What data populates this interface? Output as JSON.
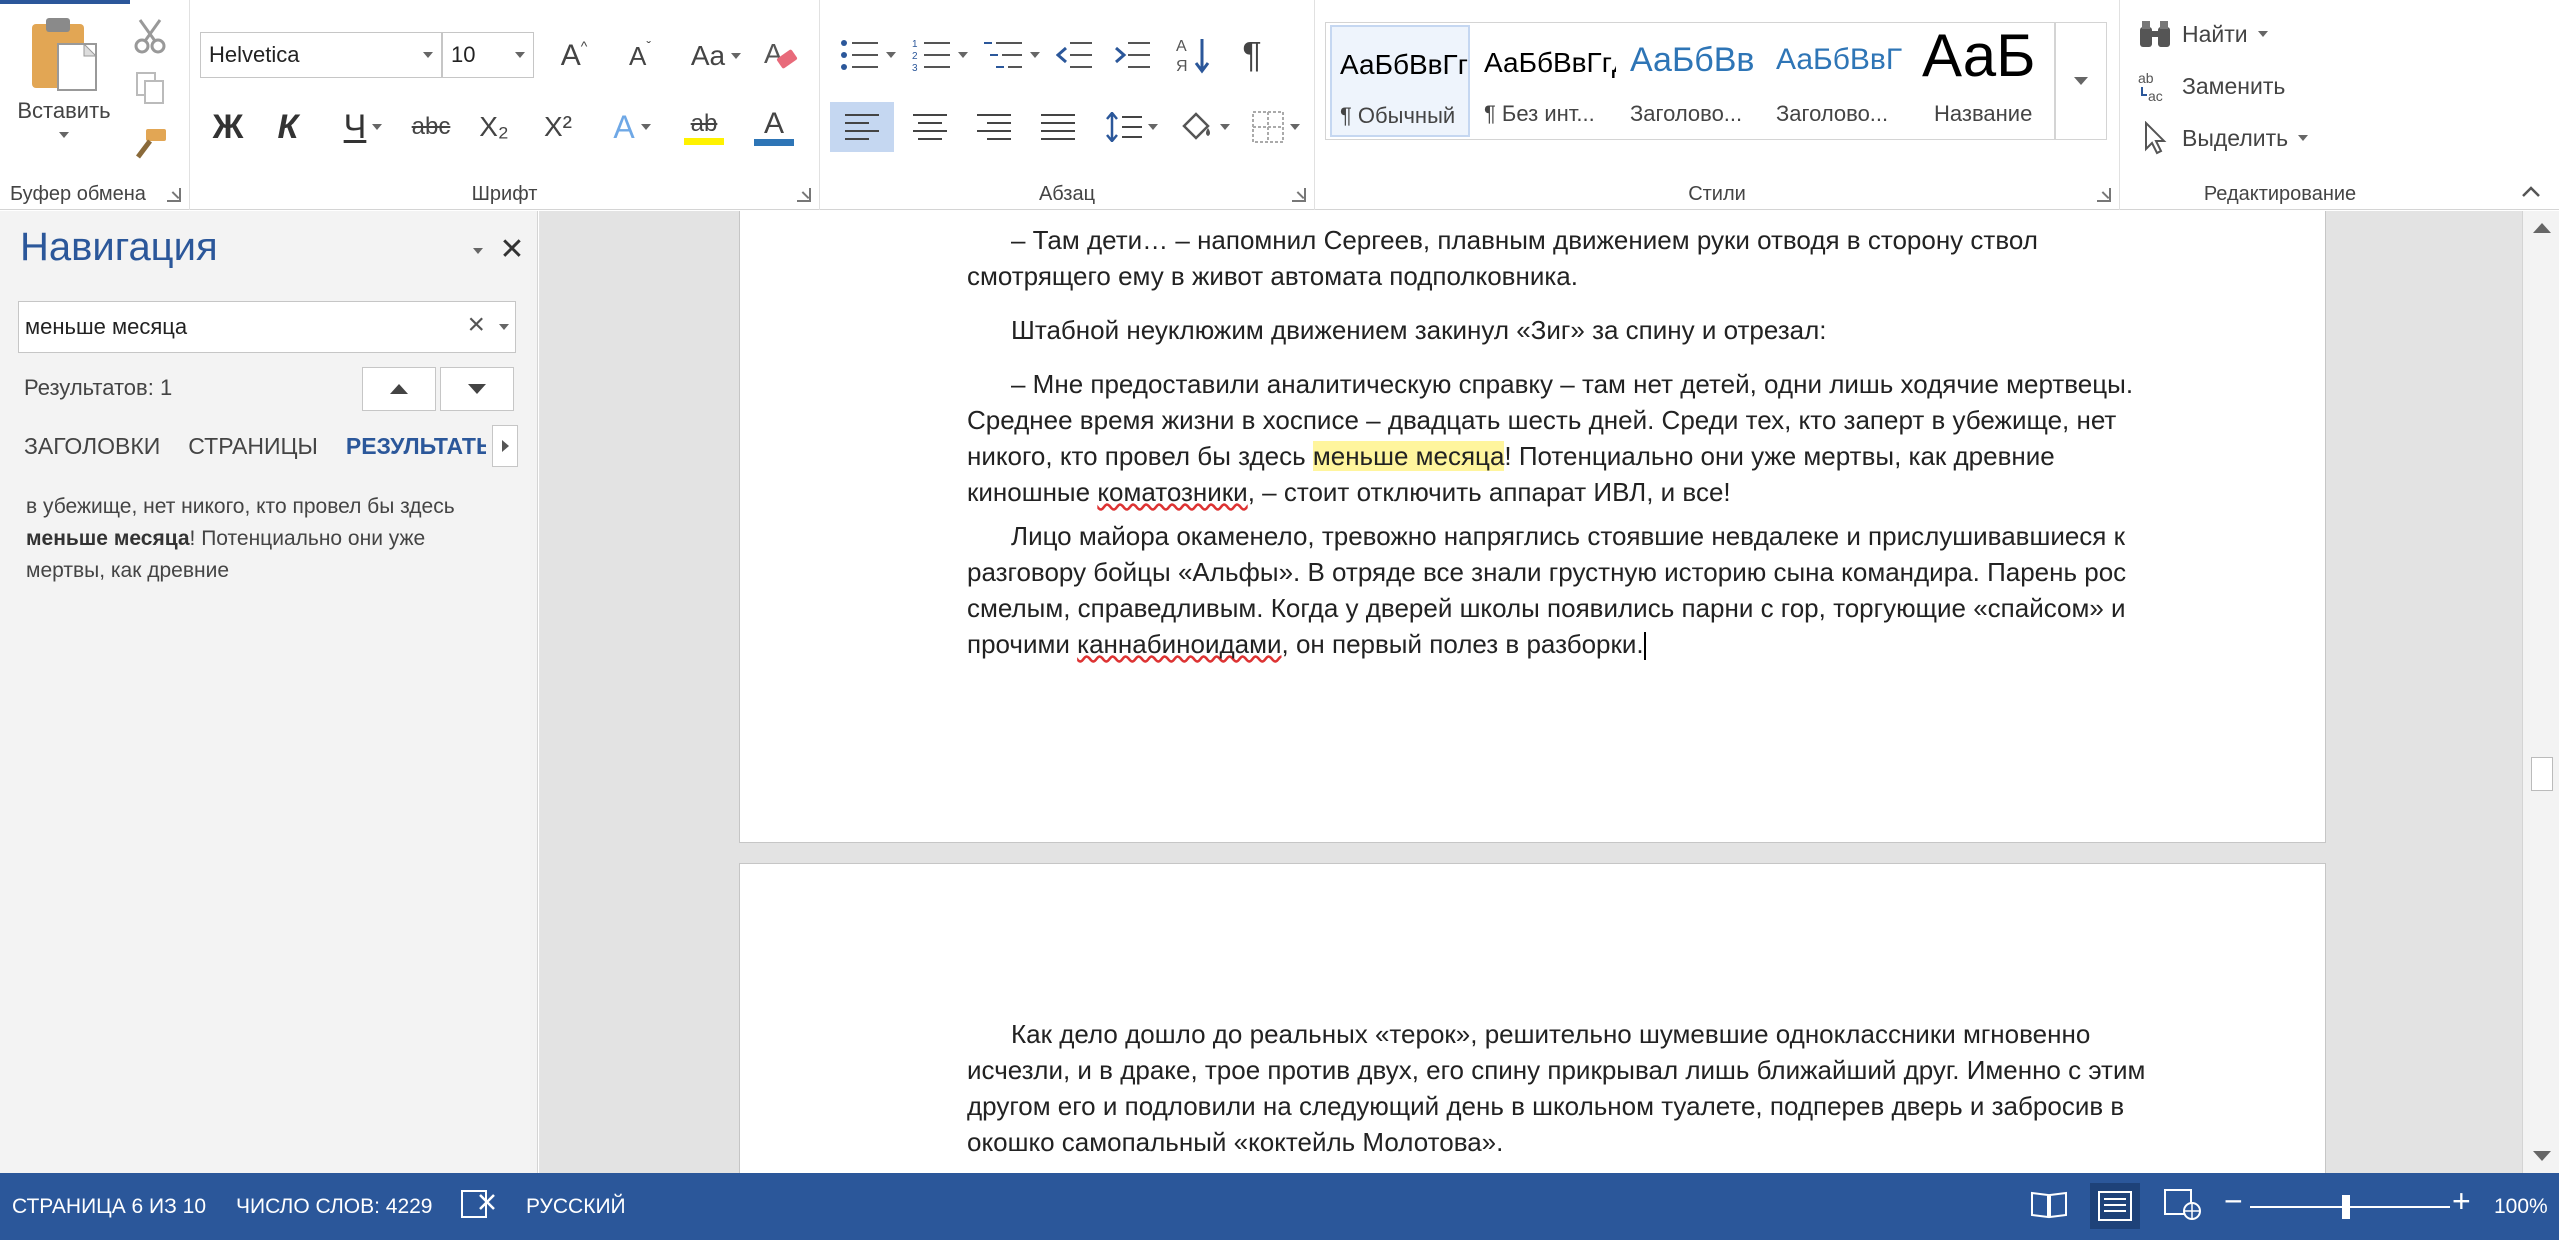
{
  "ribbon": {
    "clipboard": {
      "paste_label": "Вставить",
      "group_label": "Буфер обмена"
    },
    "font": {
      "group_label": "Шрифт",
      "font_name": "Helvetica",
      "font_size": "10",
      "bold": "Ж",
      "italic": "К",
      "underline": "Ч",
      "strike": "abc",
      "subscript": "X₂",
      "superscript": "X²",
      "grow": "A",
      "shrink": "A",
      "case": "Aa",
      "text_effects": "A",
      "font_color": "A",
      "highlight": "ab"
    },
    "paragraph": {
      "group_label": "Абзац",
      "show_marks": "¶"
    },
    "styles": {
      "group_label": "Стили",
      "items": [
        {
          "sample": "АаБбВвГгД",
          "name": "¶ Обычный"
        },
        {
          "sample": "АаБбВвГгД",
          "name": "¶ Без инт..."
        },
        {
          "sample": "АаБбВв",
          "name": "Заголово..."
        },
        {
          "sample": "АаБбВвГ",
          "name": "Заголово..."
        },
        {
          "sample": "АаБ",
          "name": "Название"
        }
      ]
    },
    "editing": {
      "group_label": "Редактирование",
      "find": "Найти",
      "replace": "Заменить",
      "select": "Выделить"
    }
  },
  "nav": {
    "title": "Навигация",
    "search_value": "меньше месяца",
    "results": "Результатов: 1",
    "tabs": [
      "ЗАГОЛОВКИ",
      "СТРАНИЦЫ",
      "РЕЗУЛЬТАТЫ"
    ],
    "snippet_before": "в убежище, нет никого, кто провел бы здесь ",
    "snippet_match": "меньше месяца",
    "snippet_after": "! Потенциально они уже мертвы, как древние"
  },
  "document": {
    "p1": "–  Там дети… – напомнил Сергеев, плавным движением руки отводя в сторону ствол смотрящего ему в живот автомата подполковника.",
    "p2": "Штабной неуклюжим движением закинул «Зиг» за спину и отрезал:",
    "p3_a": "–  Мне предоставили аналитическую справку – там нет детей, одни лишь ходячие мертвецы. Среднее время жизни в хосписе – двадцать шесть дней. Среди тех, кто заперт в убежище, нет никого, кто провел бы здесь ",
    "p3_hl": "меньше месяца",
    "p3_b": "! Потенциально они уже мертвы, как древние киношные ",
    "p3_sq": "коматозники",
    "p3_c": ", – стоит отключить аппарат ИВЛ, и все!",
    "p4_a": "Лицо майора окаменело, тревожно напряглись стоявшие невдалеке и прислушивавшиеся к разговору бойцы «Альфы». В отряде все знали грустную историю сына командира. Парень рос смелым, справедливым. Когда у дверей школы появились парни с гор, торгующие «спайсом» и прочими ",
    "p4_sq": "каннабиноидами",
    "p4_b": ", он первый полез в разборки.",
    "p5": "Как дело дошло до реальных «терок», решительно шумевшие одноклассники мгновенно исчезли, и в драке, трое против двух, его спину прикрывал лишь ближайший друг. Именно с этим другом его и подловили на следующий день в школьном туалете, подперев дверь и забросив в окошко самопальный «коктейль Молотова»."
  },
  "status": {
    "page": "СТРАНИЦА 6 ИЗ 10",
    "words": "ЧИСЛО СЛОВ: 4229",
    "language": "РУССКИЙ",
    "zoom": "100%"
  },
  "colors": {
    "accent": "#2b579a",
    "highlight": "#fff59d",
    "highlight_bar": "#fff200",
    "font_color_bar": "#2e75b6"
  }
}
